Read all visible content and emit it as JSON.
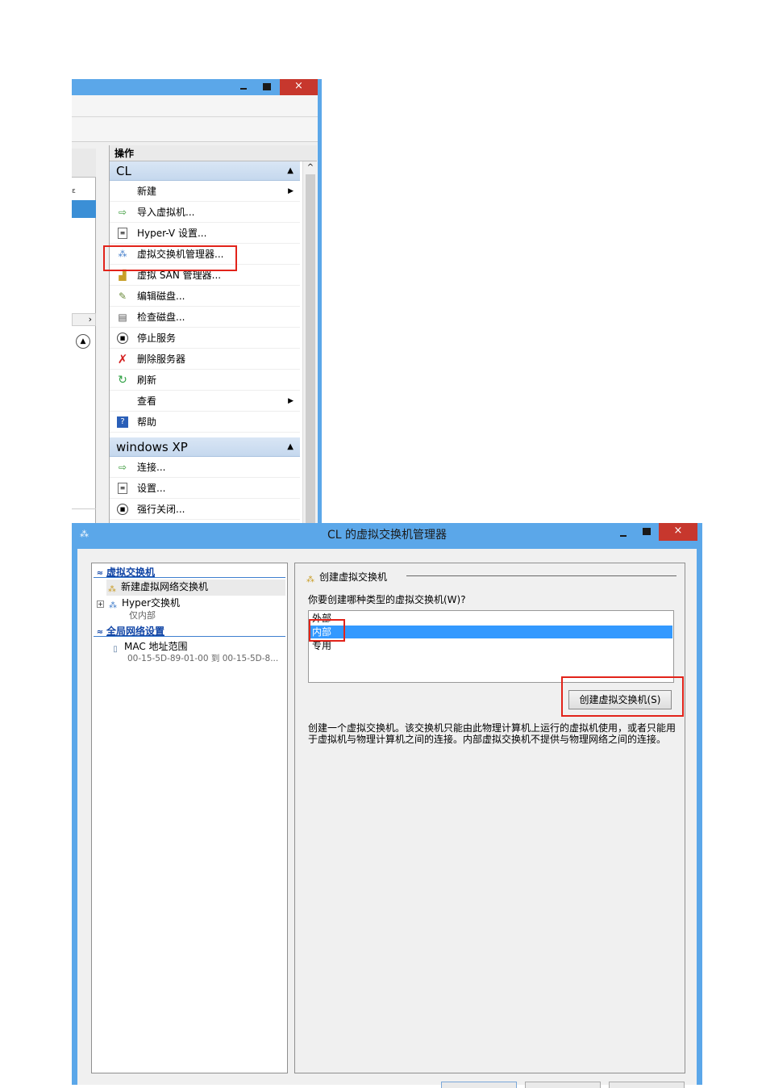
{
  "top_window": {
    "close_glyph": "×",
    "left_pane_fragment": "ɛ",
    "left_pane_chevron": "›",
    "left_pane_expand": "▲",
    "actions_header": "操作",
    "sections": [
      {
        "title": "CL",
        "items": [
          {
            "label": "新建",
            "icon": "none",
            "submenu": true
          },
          {
            "label": "导入虚拟机...",
            "icon": "import-vm-icon"
          },
          {
            "label": "Hyper-V 设置...",
            "icon": "settings-doc-icon"
          },
          {
            "label": "虚拟交换机管理器...",
            "icon": "virtual-switch-icon"
          },
          {
            "label": "虚拟 SAN 管理器...",
            "icon": "san-icon"
          },
          {
            "label": "编辑磁盘...",
            "icon": "edit-disk-icon"
          },
          {
            "label": "检查磁盘...",
            "icon": "inspect-disk-icon"
          },
          {
            "label": "停止服务",
            "icon": "stop-service-icon"
          },
          {
            "label": "删除服务器",
            "icon": "delete-icon"
          },
          {
            "label": "刷新",
            "icon": "refresh-icon"
          },
          {
            "label": "查看",
            "icon": "none",
            "submenu": true
          },
          {
            "label": "帮助",
            "icon": "help-icon"
          }
        ]
      },
      {
        "title": "windows XP",
        "items": [
          {
            "label": "连接...",
            "icon": "connect-icon"
          },
          {
            "label": "设置...",
            "icon": "settings-icon"
          },
          {
            "label": "强行关闭...",
            "icon": "turn-off-icon"
          }
        ]
      }
    ]
  },
  "dialog": {
    "title": "CL 的虚拟交换机管理器",
    "close_glyph": "×",
    "tree": {
      "section1_title": "虚拟交换机",
      "new_switch": "新建虚拟网络交换机",
      "hyper_switch": "Hyper交换机",
      "hyper_switch_sub": "仅内部",
      "section2_title": "全局网络设置",
      "mac_range": "MAC 地址范围",
      "mac_range_value": "00-15-5D-89-01-00 到 00-15-5D-8..."
    },
    "detail": {
      "group_title": "创建虚拟交换机",
      "question": "你要创建哪种类型的虚拟交换机(W)?",
      "options": [
        "外部",
        "内部",
        "专用"
      ],
      "selected_option": "内部",
      "create_button": "创建虚拟交换机(S)",
      "description": "创建一个虚拟交换机。该交换机只能由此物理计算机上运行的虚拟机使用，或者只能用于虚拟机与物理计算机之间的连接。内部虚拟交换机不提供与物理网络之间的连接。"
    }
  },
  "colors": {
    "titlebar": "#5ba7e9",
    "close_button": "#c7372d",
    "highlight": "#e2231a",
    "selection": "#3399ff"
  }
}
